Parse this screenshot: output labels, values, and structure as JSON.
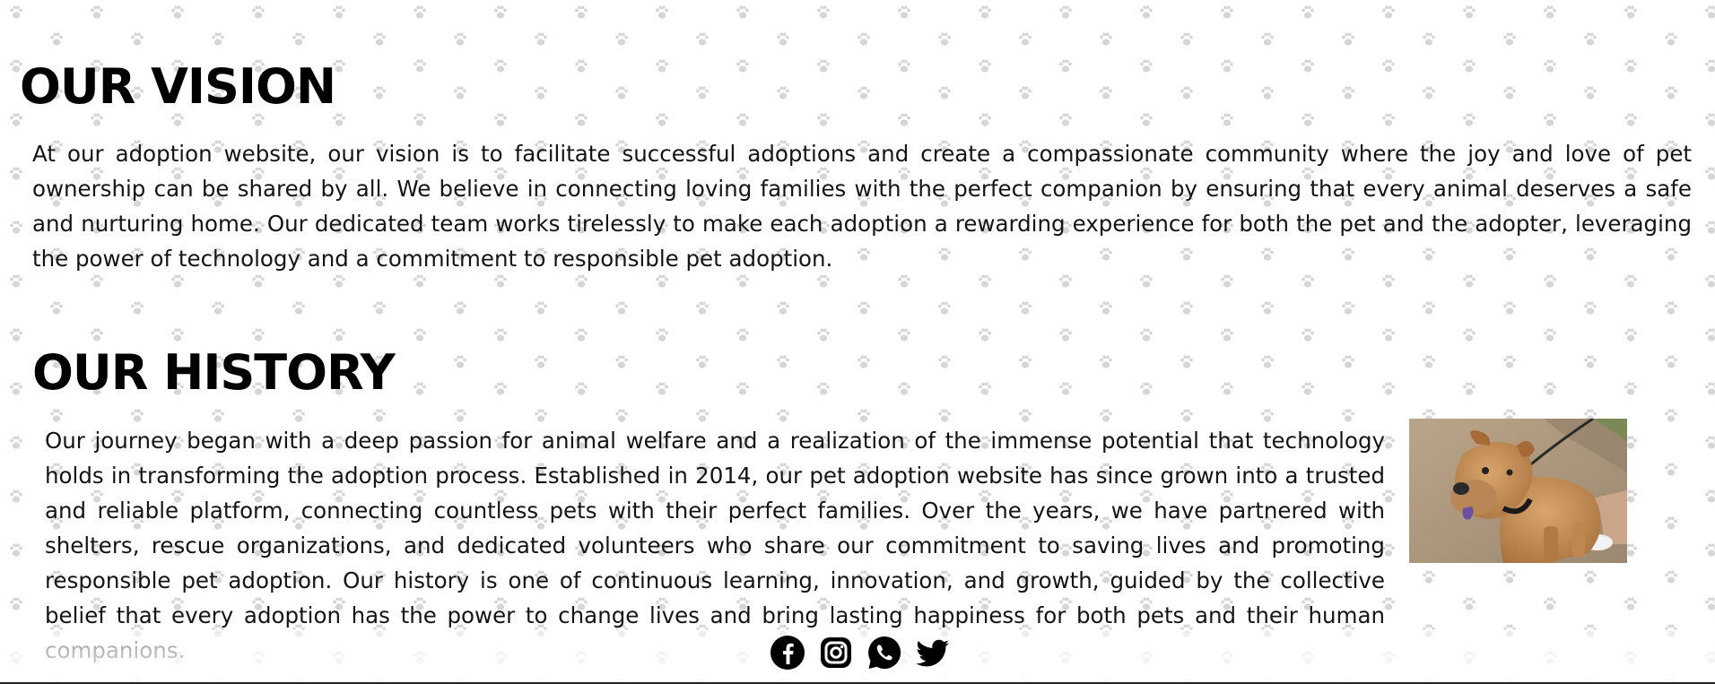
{
  "vision": {
    "title": "OUR VISION",
    "text": "At our adoption website, our vision is to facilitate successful adoptions and create a compassionate community where the joy and love of pet ownership can be shared by all. We believe in connecting loving families with the perfect companion by ensuring that every animal deserves a safe and nurturing home. Our dedicated team works tirelessly to make each adoption a rewarding experience for both the pet and the adopter, leveraging the power of technology and a commitment to responsible pet adoption."
  },
  "history": {
    "title": "OUR HISTORY",
    "text": "Our journey began with a deep passion for animal welfare and a realization of the immense potential that technology holds in transforming the adoption process. Established in 2014, our pet adoption website has since grown into a trusted and reliable platform, connecting countless pets with their perfect families. Over the years, we have partnered with shelters, rescue organizations, and dedicated volunteers who share our commitment to saving lives and promoting responsible pet adoption. Our history is one of continuous learning, innovation, and growth, guided by the collective belief that every adoption has the power to change lives and bring lasting happiness for both pets and their human companions.",
    "image_icon": "dog-photo"
  },
  "social": {
    "icons": [
      "facebook-icon",
      "instagram-icon",
      "whatsapp-icon",
      "twitter-icon"
    ]
  },
  "colors": {
    "text": "#111111",
    "background": "#ffffff",
    "paw_pattern": "#d9d9d9"
  }
}
